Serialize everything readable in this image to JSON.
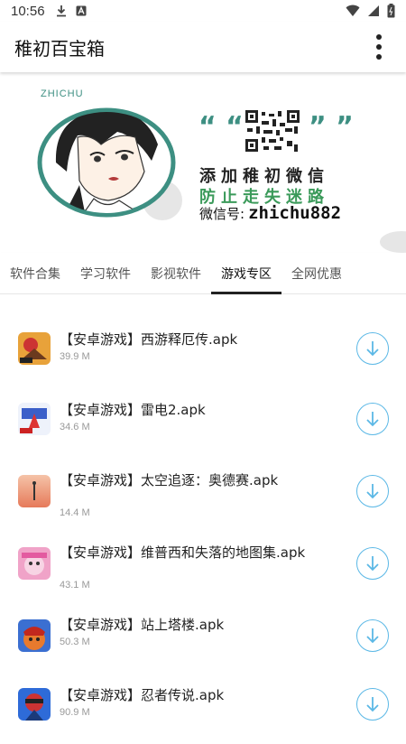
{
  "status_bar": {
    "time": "10:56"
  },
  "app_bar": {
    "title": "稚初百宝箱",
    "menu_icon": "more-vert-icon"
  },
  "banner": {
    "brand": "ZHICHU",
    "line1": "添加稚初微信",
    "line2": "防止走失迷路",
    "id_label": "微信号:",
    "id_value": "zhichu882",
    "accent_color": "#3d8f82",
    "green_color": "#3b9a5a"
  },
  "tabs": [
    {
      "label": "软件合集",
      "active": false
    },
    {
      "label": "学习软件",
      "active": false
    },
    {
      "label": "影视软件",
      "active": false
    },
    {
      "label": "游戏专区",
      "active": true
    },
    {
      "label": "全网优惠",
      "active": false
    }
  ],
  "items": [
    {
      "title": "【安卓游戏】西游释厄传.apk",
      "size": "39.9 M"
    },
    {
      "title": "【安卓游戏】雷电2.apk",
      "size": "34.6 M"
    },
    {
      "title": "【安卓游戏】太空追逐：奥德赛.apk",
      "size": "14.4 M"
    },
    {
      "title": "【安卓游戏】维普西和失落的地图集.apk",
      "size": "43.1 M"
    },
    {
      "title": "【安卓游戏】站上塔楼.apk",
      "size": "50.3 M"
    },
    {
      "title": "【安卓游戏】忍者传说.apk",
      "size": "90.9 M"
    }
  ],
  "colors": {
    "download_accent": "#5bb8e6"
  }
}
